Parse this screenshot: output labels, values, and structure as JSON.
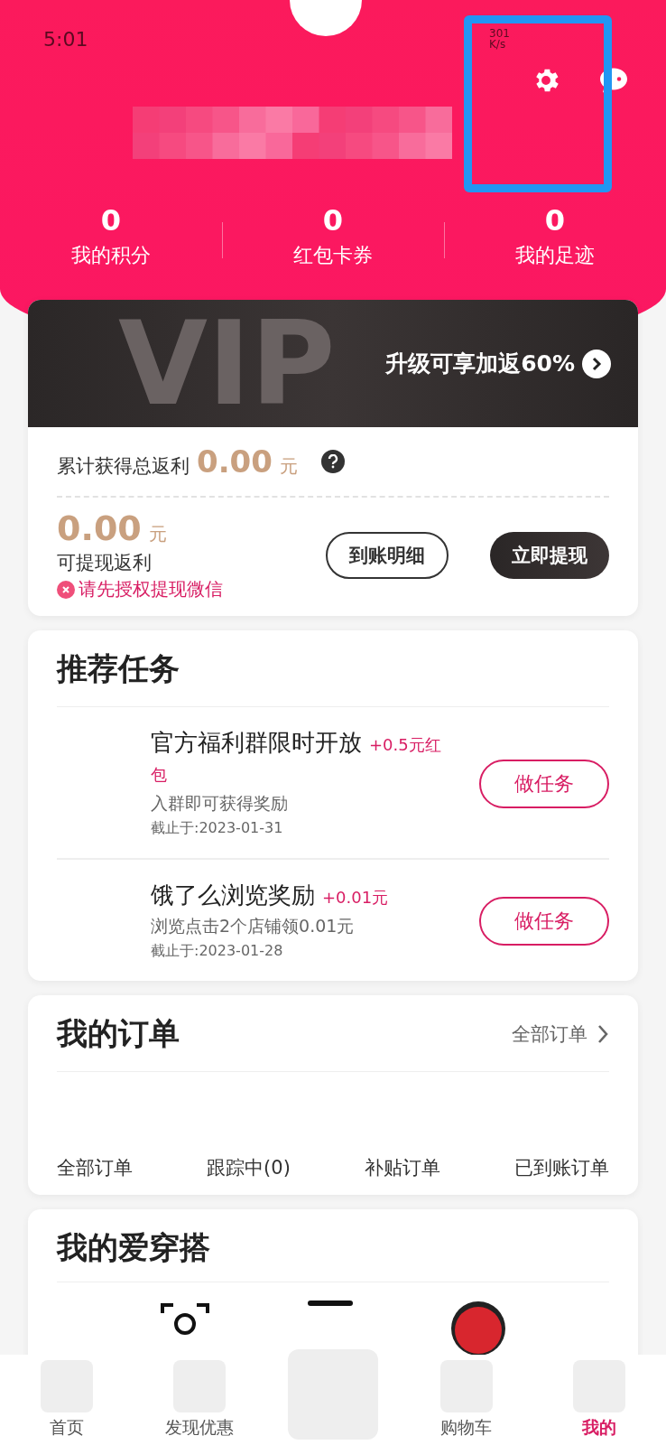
{
  "status_bar": {
    "time": "5:01",
    "network_speed": "301 K/s"
  },
  "header": {
    "stats": [
      {
        "value": "0",
        "label": "我的积分"
      },
      {
        "value": "0",
        "label": "红包卡券"
      },
      {
        "value": "0",
        "label": "我的足迹"
      }
    ]
  },
  "vip_card": {
    "background_text": "VIP",
    "promo": "升级可享加返60%",
    "total_label": "累计获得总返利",
    "total_value": "0.00",
    "total_unit": "元",
    "available_value": "0.00",
    "available_unit": "元",
    "available_label": "可提现返利",
    "warning": "请先授权提现微信",
    "buttons": [
      {
        "label": "到账明细",
        "kind": "outline"
      },
      {
        "label": "立即提现",
        "kind": "filled"
      }
    ]
  },
  "tasks": {
    "title": "推荐任务",
    "items": [
      {
        "title": "官方福利群限时开放",
        "reward": "+0.5元红包",
        "description": "入群即可获得奖励",
        "deadline": "截止于:2023-01-31",
        "button": "做任务"
      },
      {
        "title": "饿了么浏览奖励",
        "reward": "+0.01元",
        "description": "浏览点击2个店铺领0.01元",
        "deadline": "截止于:2023-01-28",
        "button": "做任务"
      }
    ]
  },
  "orders": {
    "title": "我的订单",
    "link": "全部订单",
    "tabs": [
      "全部订单",
      "跟踪中(0)",
      "补贴订单",
      "已到账订单"
    ]
  },
  "outfit": {
    "title": "我的爱穿搭"
  },
  "bottom_nav": [
    {
      "kind": "tab",
      "label": "首页",
      "selected": false
    },
    {
      "kind": "tab",
      "label": "发现优惠",
      "selected": false
    },
    {
      "kind": "center"
    },
    {
      "kind": "tab",
      "label": "购物车",
      "selected": false
    },
    {
      "kind": "tab",
      "label": "我的",
      "selected": true
    }
  ]
}
